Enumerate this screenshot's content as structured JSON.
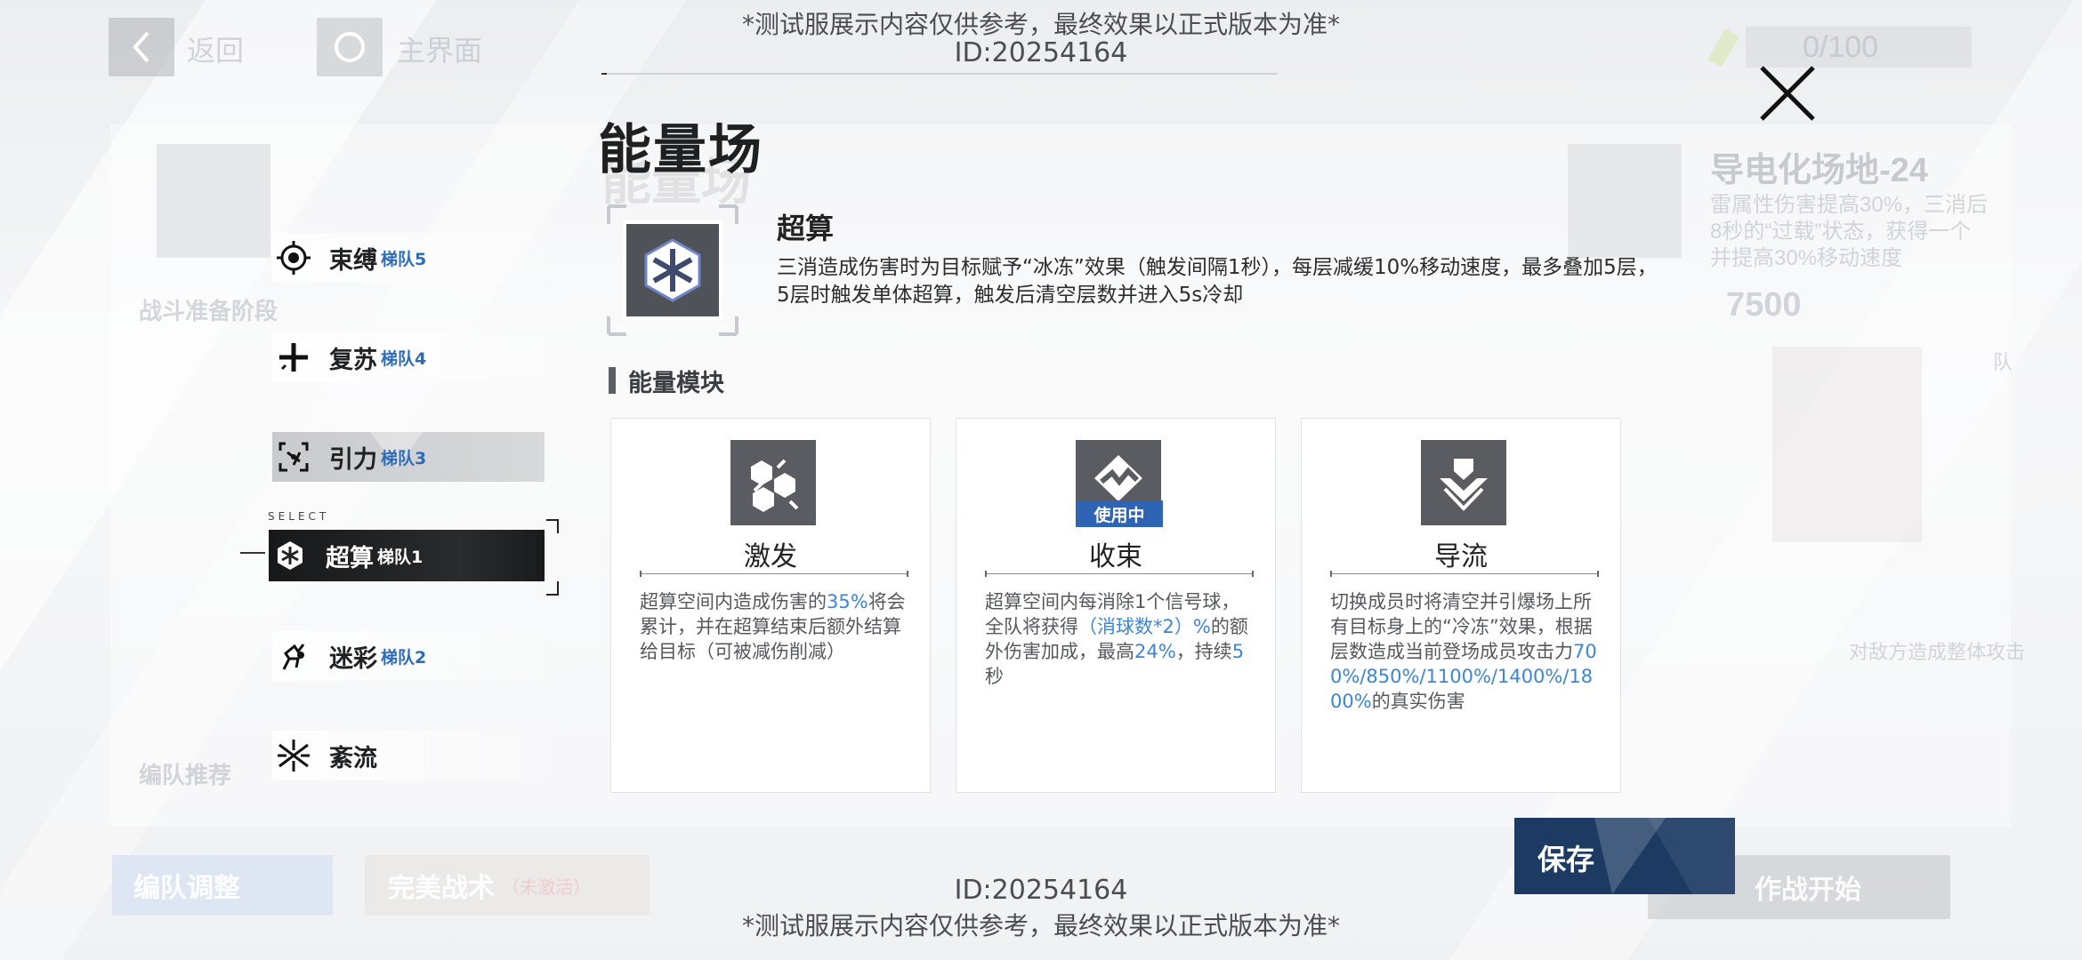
{
  "watermark": {
    "notice": "*测试服展示内容仅供参考，最终效果以正式版本为准*",
    "id": "ID:20254164"
  },
  "background": {
    "back_label": "返回",
    "home_label": "主界面",
    "stamina": "0/100",
    "field_title": "导电化场地-24",
    "field_desc_1": "雷属性伤害提高30%，三消后",
    "field_desc_2": "8秒的“过载”状态，获得一个",
    "field_desc_3": "并提高30%移动速度",
    "score": "7500",
    "left_section": "战斗准备阶段",
    "left_section_2": "编队推荐",
    "right_hint": "对敌方造成整体攻击",
    "team_adjust": "编队调整",
    "perfect_tactic": "完美战术",
    "perfect_tactic_note": "（未激活）",
    "start": "作战开始",
    "right_tag": "队"
  },
  "modal": {
    "title": "能量场",
    "close_icon": "close-icon",
    "select_label": "SELECT",
    "side_items": [
      {
        "name": "束缚",
        "team": "梯队5",
        "icon": "target-icon"
      },
      {
        "name": "复苏",
        "team": "梯队4",
        "icon": "plus-icon"
      },
      {
        "name": "引力",
        "team": "梯队3",
        "icon": "gravity-icon"
      },
      {
        "name": "超算",
        "team": "梯队1",
        "icon": "snowflake-hex-icon"
      },
      {
        "name": "迷彩",
        "team": "梯队2",
        "icon": "camo-icon"
      },
      {
        "name": "紊流",
        "team": "",
        "icon": "turbulence-icon"
      }
    ],
    "skill": {
      "name": "超算",
      "description": "三消造成伤害时为目标赋予“冰冻”效果（触发间隔1秒），每层减缓10%移动速度，最多叠加5层，5层时触发单体超算，触发后清空层数并进入5s冷却"
    },
    "section_title": "能量模块",
    "modules": [
      {
        "name": "激发",
        "icon": "cube-burst-icon",
        "badge": "",
        "text_parts": [
          "超算空间内造成伤害的",
          "35%",
          "将会累计，并在超算结束后额外结算给目标（可被减伤削减）"
        ]
      },
      {
        "name": "收束",
        "icon": "converge-icon",
        "badge": "使用中",
        "text_parts": [
          "超算空间内每消除1个信号球，全队将获得",
          "（消球数*2）%",
          "的额外伤害加成，最高",
          "24%",
          "，持续",
          "5",
          "秒"
        ]
      },
      {
        "name": "导流",
        "icon": "drain-down-icon",
        "badge": "",
        "text_parts": [
          "切换成员时将清空并引爆场上所有目标身上的“冷冻”效果，根据层数造成当前登场成员攻击力",
          "700%/850%/1100%/1400%/1800%",
          "的真实伤害"
        ]
      }
    ],
    "save_label": "保存"
  },
  "colors": {
    "accent_blue": "#2f63b4",
    "highlight_blue": "#3c86d6",
    "save_bg": "#1d3a63",
    "selected_bg": "#1a1b1d"
  }
}
